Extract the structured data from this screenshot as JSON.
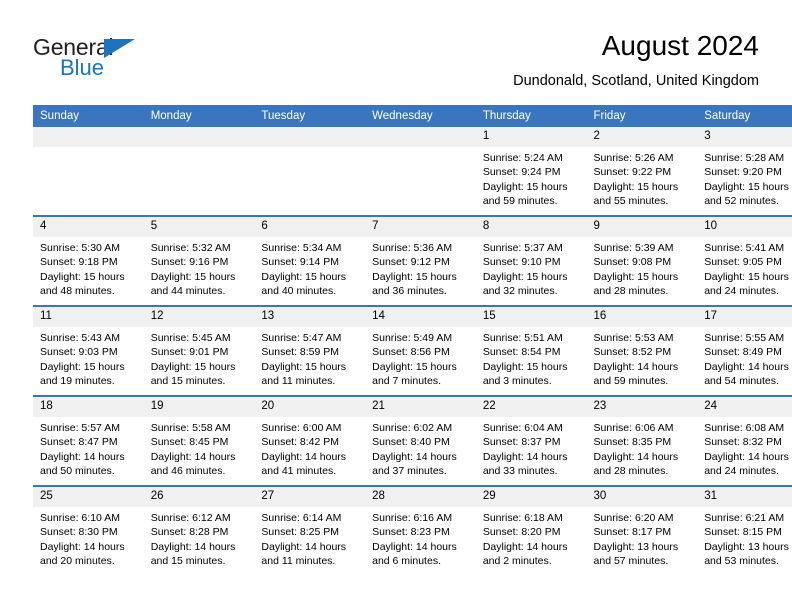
{
  "brand": {
    "word1": "General",
    "word2": "Blue",
    "accent_color": "#1c75bc",
    "text_color": "#231f20"
  },
  "header": {
    "month_title": "August 2024",
    "location": "Dundonald, Scotland, United Kingdom"
  },
  "calendar": {
    "header_color": "#3a76bf",
    "daynum_band_color": "#f0f0f0",
    "weekday_labels": [
      "Sunday",
      "Monday",
      "Tuesday",
      "Wednesday",
      "Thursday",
      "Friday",
      "Saturday"
    ],
    "weeks": [
      [
        {
          "day": "",
          "empty": true
        },
        {
          "day": "",
          "empty": true
        },
        {
          "day": "",
          "empty": true
        },
        {
          "day": "",
          "empty": true
        },
        {
          "day": "1",
          "sunrise": "Sunrise: 5:24 AM",
          "sunset": "Sunset: 9:24 PM",
          "daylight1": "Daylight: 15 hours",
          "daylight2": "and 59 minutes."
        },
        {
          "day": "2",
          "sunrise": "Sunrise: 5:26 AM",
          "sunset": "Sunset: 9:22 PM",
          "daylight1": "Daylight: 15 hours",
          "daylight2": "and 55 minutes."
        },
        {
          "day": "3",
          "sunrise": "Sunrise: 5:28 AM",
          "sunset": "Sunset: 9:20 PM",
          "daylight1": "Daylight: 15 hours",
          "daylight2": "and 52 minutes."
        }
      ],
      [
        {
          "day": "4",
          "sunrise": "Sunrise: 5:30 AM",
          "sunset": "Sunset: 9:18 PM",
          "daylight1": "Daylight: 15 hours",
          "daylight2": "and 48 minutes."
        },
        {
          "day": "5",
          "sunrise": "Sunrise: 5:32 AM",
          "sunset": "Sunset: 9:16 PM",
          "daylight1": "Daylight: 15 hours",
          "daylight2": "and 44 minutes."
        },
        {
          "day": "6",
          "sunrise": "Sunrise: 5:34 AM",
          "sunset": "Sunset: 9:14 PM",
          "daylight1": "Daylight: 15 hours",
          "daylight2": "and 40 minutes."
        },
        {
          "day": "7",
          "sunrise": "Sunrise: 5:36 AM",
          "sunset": "Sunset: 9:12 PM",
          "daylight1": "Daylight: 15 hours",
          "daylight2": "and 36 minutes."
        },
        {
          "day": "8",
          "sunrise": "Sunrise: 5:37 AM",
          "sunset": "Sunset: 9:10 PM",
          "daylight1": "Daylight: 15 hours",
          "daylight2": "and 32 minutes."
        },
        {
          "day": "9",
          "sunrise": "Sunrise: 5:39 AM",
          "sunset": "Sunset: 9:08 PM",
          "daylight1": "Daylight: 15 hours",
          "daylight2": "and 28 minutes."
        },
        {
          "day": "10",
          "sunrise": "Sunrise: 5:41 AM",
          "sunset": "Sunset: 9:05 PM",
          "daylight1": "Daylight: 15 hours",
          "daylight2": "and 24 minutes."
        }
      ],
      [
        {
          "day": "11",
          "sunrise": "Sunrise: 5:43 AM",
          "sunset": "Sunset: 9:03 PM",
          "daylight1": "Daylight: 15 hours",
          "daylight2": "and 19 minutes."
        },
        {
          "day": "12",
          "sunrise": "Sunrise: 5:45 AM",
          "sunset": "Sunset: 9:01 PM",
          "daylight1": "Daylight: 15 hours",
          "daylight2": "and 15 minutes."
        },
        {
          "day": "13",
          "sunrise": "Sunrise: 5:47 AM",
          "sunset": "Sunset: 8:59 PM",
          "daylight1": "Daylight: 15 hours",
          "daylight2": "and 11 minutes."
        },
        {
          "day": "14",
          "sunrise": "Sunrise: 5:49 AM",
          "sunset": "Sunset: 8:56 PM",
          "daylight1": "Daylight: 15 hours",
          "daylight2": "and 7 minutes."
        },
        {
          "day": "15",
          "sunrise": "Sunrise: 5:51 AM",
          "sunset": "Sunset: 8:54 PM",
          "daylight1": "Daylight: 15 hours",
          "daylight2": "and 3 minutes."
        },
        {
          "day": "16",
          "sunrise": "Sunrise: 5:53 AM",
          "sunset": "Sunset: 8:52 PM",
          "daylight1": "Daylight: 14 hours",
          "daylight2": "and 59 minutes."
        },
        {
          "day": "17",
          "sunrise": "Sunrise: 5:55 AM",
          "sunset": "Sunset: 8:49 PM",
          "daylight1": "Daylight: 14 hours",
          "daylight2": "and 54 minutes."
        }
      ],
      [
        {
          "day": "18",
          "sunrise": "Sunrise: 5:57 AM",
          "sunset": "Sunset: 8:47 PM",
          "daylight1": "Daylight: 14 hours",
          "daylight2": "and 50 minutes."
        },
        {
          "day": "19",
          "sunrise": "Sunrise: 5:58 AM",
          "sunset": "Sunset: 8:45 PM",
          "daylight1": "Daylight: 14 hours",
          "daylight2": "and 46 minutes."
        },
        {
          "day": "20",
          "sunrise": "Sunrise: 6:00 AM",
          "sunset": "Sunset: 8:42 PM",
          "daylight1": "Daylight: 14 hours",
          "daylight2": "and 41 minutes."
        },
        {
          "day": "21",
          "sunrise": "Sunrise: 6:02 AM",
          "sunset": "Sunset: 8:40 PM",
          "daylight1": "Daylight: 14 hours",
          "daylight2": "and 37 minutes."
        },
        {
          "day": "22",
          "sunrise": "Sunrise: 6:04 AM",
          "sunset": "Sunset: 8:37 PM",
          "daylight1": "Daylight: 14 hours",
          "daylight2": "and 33 minutes."
        },
        {
          "day": "23",
          "sunrise": "Sunrise: 6:06 AM",
          "sunset": "Sunset: 8:35 PM",
          "daylight1": "Daylight: 14 hours",
          "daylight2": "and 28 minutes."
        },
        {
          "day": "24",
          "sunrise": "Sunrise: 6:08 AM",
          "sunset": "Sunset: 8:32 PM",
          "daylight1": "Daylight: 14 hours",
          "daylight2": "and 24 minutes."
        }
      ],
      [
        {
          "day": "25",
          "sunrise": "Sunrise: 6:10 AM",
          "sunset": "Sunset: 8:30 PM",
          "daylight1": "Daylight: 14 hours",
          "daylight2": "and 20 minutes."
        },
        {
          "day": "26",
          "sunrise": "Sunrise: 6:12 AM",
          "sunset": "Sunset: 8:28 PM",
          "daylight1": "Daylight: 14 hours",
          "daylight2": "and 15 minutes."
        },
        {
          "day": "27",
          "sunrise": "Sunrise: 6:14 AM",
          "sunset": "Sunset: 8:25 PM",
          "daylight1": "Daylight: 14 hours",
          "daylight2": "and 11 minutes."
        },
        {
          "day": "28",
          "sunrise": "Sunrise: 6:16 AM",
          "sunset": "Sunset: 8:23 PM",
          "daylight1": "Daylight: 14 hours",
          "daylight2": "and 6 minutes."
        },
        {
          "day": "29",
          "sunrise": "Sunrise: 6:18 AM",
          "sunset": "Sunset: 8:20 PM",
          "daylight1": "Daylight: 14 hours",
          "daylight2": "and 2 minutes."
        },
        {
          "day": "30",
          "sunrise": "Sunrise: 6:20 AM",
          "sunset": "Sunset: 8:17 PM",
          "daylight1": "Daylight: 13 hours",
          "daylight2": "and 57 minutes."
        },
        {
          "day": "31",
          "sunrise": "Sunrise: 6:21 AM",
          "sunset": "Sunset: 8:15 PM",
          "daylight1": "Daylight: 13 hours",
          "daylight2": "and 53 minutes."
        }
      ]
    ]
  }
}
